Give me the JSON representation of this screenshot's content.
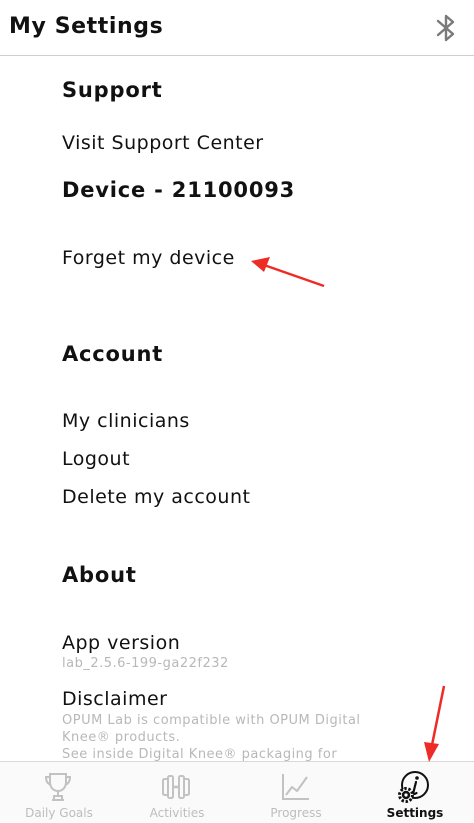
{
  "header": {
    "title": "My Settings",
    "icon": "bluetooth-icon"
  },
  "sections": {
    "support": {
      "title": "Support",
      "items": [
        "Visit Support Center"
      ]
    },
    "device": {
      "title": "Device - 21100093",
      "items": [
        "Forget my device"
      ]
    },
    "account": {
      "title": "Account",
      "items": [
        "My clinicians",
        "Logout",
        "Delete my account"
      ]
    },
    "about": {
      "title": "About",
      "app_version_label": "App version",
      "app_version_value": "lab_2.5.6-199-ga22f232",
      "disclaimer_label": "Disclaimer",
      "disclaimer_lines": [
        "OPUM Lab is compatible with OPUM Digital",
        "Knee® products.",
        "See inside Digital Knee® packaging for"
      ]
    }
  },
  "tabbar": {
    "tabs": [
      {
        "label": "Daily Goals",
        "icon": "trophy-icon",
        "active": false
      },
      {
        "label": "Activities",
        "icon": "dumbbell-icon",
        "active": false
      },
      {
        "label": "Progress",
        "icon": "line-chart-icon",
        "active": false
      },
      {
        "label": "Settings",
        "icon": "info-gear-icon",
        "active": true
      }
    ]
  },
  "colors": {
    "annotation_arrow": "#ee2b24",
    "inactive_tab": "#bdbdbd",
    "active_tab": "#111111"
  }
}
